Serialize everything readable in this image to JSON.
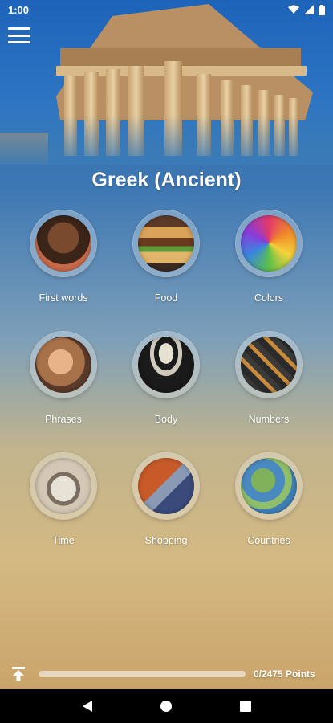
{
  "status_bar": {
    "time": "1:00"
  },
  "header": {
    "title": "Greek (Ancient)"
  },
  "categories": [
    {
      "label": "First words",
      "icon": "child-face-photo"
    },
    {
      "label": "Food",
      "icon": "burger-photo"
    },
    {
      "label": "Colors",
      "icon": "color-powder-photo"
    },
    {
      "label": "Phrases",
      "icon": "smiling-woman-photo"
    },
    {
      "label": "Body",
      "icon": "skeleton-photo"
    },
    {
      "label": "Numbers",
      "icon": "number-blocks-photo"
    },
    {
      "label": "Time",
      "icon": "alarm-clock-photo"
    },
    {
      "label": "Shopping",
      "icon": "shopping-cart-photo"
    },
    {
      "label": "Countries",
      "icon": "map-photo"
    }
  ],
  "footer": {
    "points_text": "0/2475 Points",
    "progress": 0
  },
  "colors": {
    "sky_blue": "#2d75c3",
    "sand": "#d4b982"
  }
}
